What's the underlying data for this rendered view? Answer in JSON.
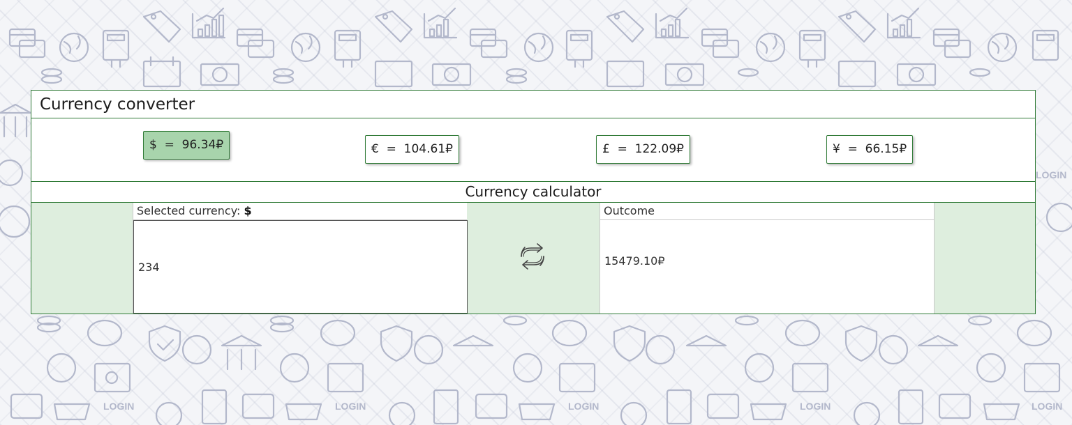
{
  "app": {
    "title": "Currency converter"
  },
  "rates": [
    {
      "symbol": "$",
      "value": "96.34₽",
      "label": "$  =  96.34₽",
      "selected": true
    },
    {
      "symbol": "€",
      "value": "104.61₽",
      "label": "€  =  104.61₽",
      "selected": false
    },
    {
      "symbol": "£",
      "value": "122.09₽",
      "label": "£  =  122.09₽",
      "selected": false
    },
    {
      "symbol": "¥",
      "value": "66.15₽",
      "label": "¥  =  66.15₽",
      "selected": false
    }
  ],
  "calculator": {
    "title": "Currency calculator",
    "selected_label": "Selected currency:",
    "selected_symbol": "$",
    "amount_value": "234",
    "swap_icon": "swap-arrows-icon",
    "outcome_label": "Outcome",
    "outcome_value": "15479.10₽"
  },
  "background": {
    "icons": [
      "credit-card-icon",
      "globe-icon",
      "calculator-icon",
      "calendar-icon",
      "banknote-icon",
      "coin-stack-icon",
      "price-tag-icon",
      "bar-chart-icon",
      "piggy-bank-icon",
      "bank-icon",
      "shield-check-icon",
      "percent-icon",
      "safe-icon",
      "cart-icon",
      "login-icon",
      "wallet-icon",
      "clock-icon",
      "checklist-icon"
    ],
    "login_text": "LOGIN"
  },
  "colors": {
    "accent_border": "#2f7a36",
    "selected_chip": "#a8d4ac",
    "calc_row_bg": "#deeede",
    "background_icons": "#b0b6ca"
  }
}
